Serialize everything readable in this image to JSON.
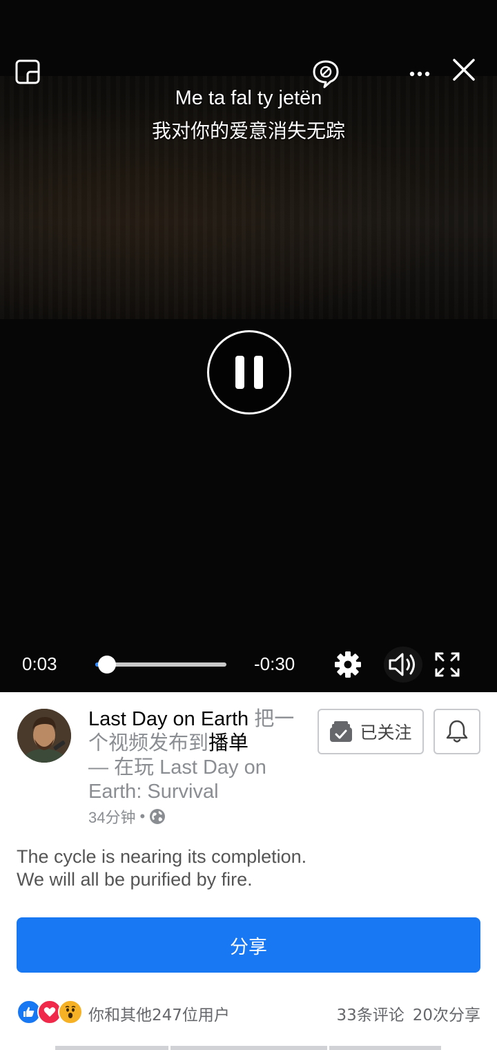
{
  "player": {
    "subtitle_line1": "Me ta fal ty jetën",
    "subtitle_line2": "我对你的爱意消失无踪",
    "elapsed": "0:03",
    "remaining": "-0:30",
    "progress_fraction": 0.09
  },
  "post": {
    "page_name": "Last Day on Earth",
    "action_text_1": " 把一个视频发布到",
    "playlist_word": "播单",
    "action_text_2": "— 在玩 Last Day on Earth: Survival",
    "time_ago": "34分钟",
    "dot": "•",
    "follow_label": "已关注",
    "caption_line1": "The cycle is nearing its completion.",
    "caption_line2": "We will all be purified by fire.",
    "share_label": "分享",
    "reactions_text": "你和其他247位用户",
    "comments_count": "33条评论",
    "shares_count": "20次分享"
  },
  "colors": {
    "accent": "#1877f2",
    "like": "#1877f2",
    "love": "#f02849",
    "wow": "#f7b125"
  }
}
